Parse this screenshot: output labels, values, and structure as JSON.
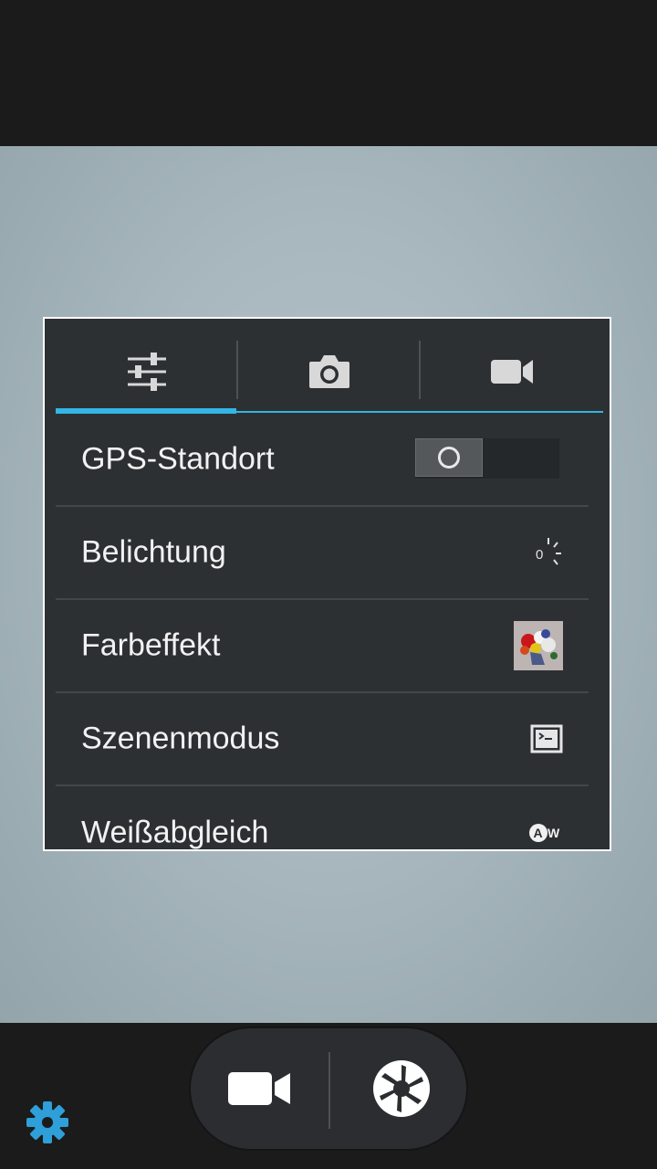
{
  "panel": {
    "tabs": [
      {
        "icon": "sliders-icon"
      },
      {
        "icon": "camera-icon"
      },
      {
        "icon": "video-camera-icon"
      }
    ],
    "items": [
      {
        "label": "GPS-Standort",
        "control": "toggle-switch",
        "state": "off"
      },
      {
        "label": "Belichtung",
        "value": "0",
        "icon": "exposure-icon"
      },
      {
        "label": "Farbeffekt",
        "icon": "color-effect-thumbnail"
      },
      {
        "label": "Szenenmodus",
        "icon": "scene-mode-icon"
      },
      {
        "label": "Weißabgleich",
        "icon": "auto-white-balance-icon",
        "value": "AW"
      }
    ]
  },
  "controls": {
    "video_button": {
      "icon": "video-camera-icon"
    },
    "shutter_button": {
      "icon": "shutter-icon"
    },
    "settings_button": {
      "icon": "gear-icon"
    }
  },
  "colors": {
    "accent": "#33b5e5",
    "panel_bg": "#2d3033",
    "bar_bg": "#1b1b1b"
  }
}
